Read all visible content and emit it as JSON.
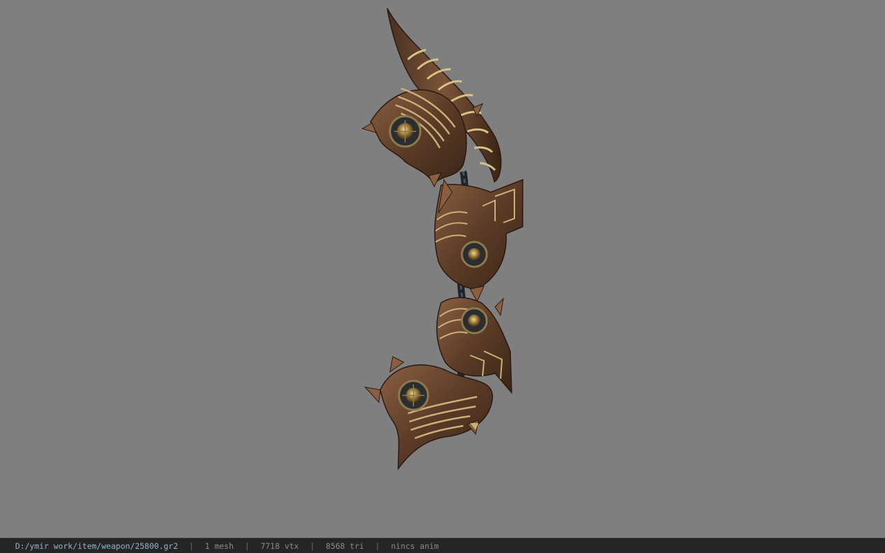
{
  "viewport": {
    "background": "#7f7f7f",
    "model_icon": "ornate-bow-model-icon"
  },
  "statusbar": {
    "file_path": "D:/ymir work/item/weapon/25800.gr2",
    "separator": "|",
    "mesh_count": "1 mesh",
    "vertex_count": "7718 vtx",
    "triangle_count": "8568 tri",
    "animation": "nincs anim"
  },
  "colors": {
    "statusbar_bg": "#252525",
    "path_text": "#8fb4c9",
    "info_text": "#8a8a8a",
    "bow_bronze": "#6b4a33",
    "bow_gold": "#c9b27a"
  }
}
